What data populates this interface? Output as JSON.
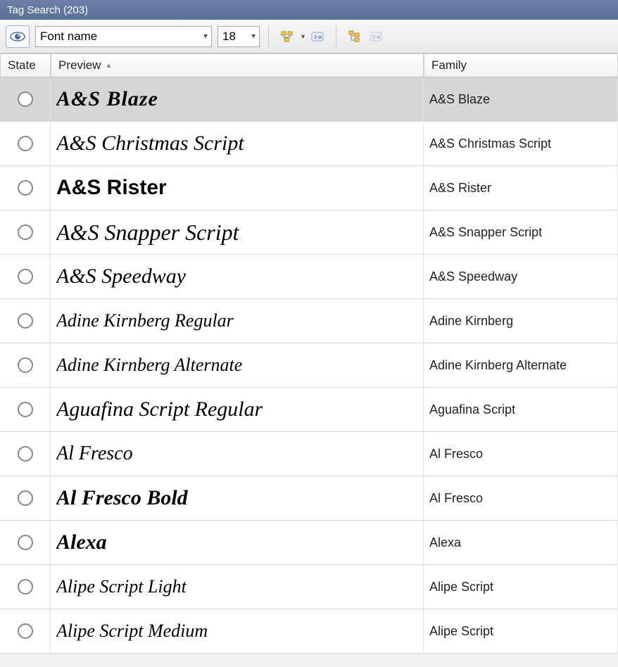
{
  "titlebar": {
    "text": "Tag Search (203)"
  },
  "toolbar": {
    "font_name_value": "Font name",
    "size_value": "18"
  },
  "columns": {
    "state": "State",
    "preview": "Preview",
    "family": "Family"
  },
  "rows": [
    {
      "preview": "A&S Blaze",
      "family": "A&S Blaze",
      "selected": true
    },
    {
      "preview": "A&S Christmas Script",
      "family": "A&S Christmas Script",
      "selected": false
    },
    {
      "preview": "A&S Rister",
      "family": "A&S Rister",
      "selected": false
    },
    {
      "preview": "A&S Snapper Script",
      "family": "A&S Snapper Script",
      "selected": false
    },
    {
      "preview": "A&S Speedway",
      "family": "A&S Speedway",
      "selected": false
    },
    {
      "preview": "Adine Kirnberg Regular",
      "family": "Adine Kirnberg",
      "selected": false
    },
    {
      "preview": "Adine Kirnberg Alternate",
      "family": "Adine Kirnberg Alternate",
      "selected": false
    },
    {
      "preview": "Aguafina Script Regular",
      "family": "Aguafina Script",
      "selected": false
    },
    {
      "preview": "Al Fresco",
      "family": "Al Fresco",
      "selected": false
    },
    {
      "preview": "Al Fresco Bold",
      "family": "Al Fresco",
      "selected": false
    },
    {
      "preview": "Alexa",
      "family": "Alexa",
      "selected": false
    },
    {
      "preview": "Alipe Script Light",
      "family": "Alipe Script",
      "selected": false
    },
    {
      "preview": "Alipe Script Medium",
      "family": "Alipe Script",
      "selected": false
    }
  ]
}
